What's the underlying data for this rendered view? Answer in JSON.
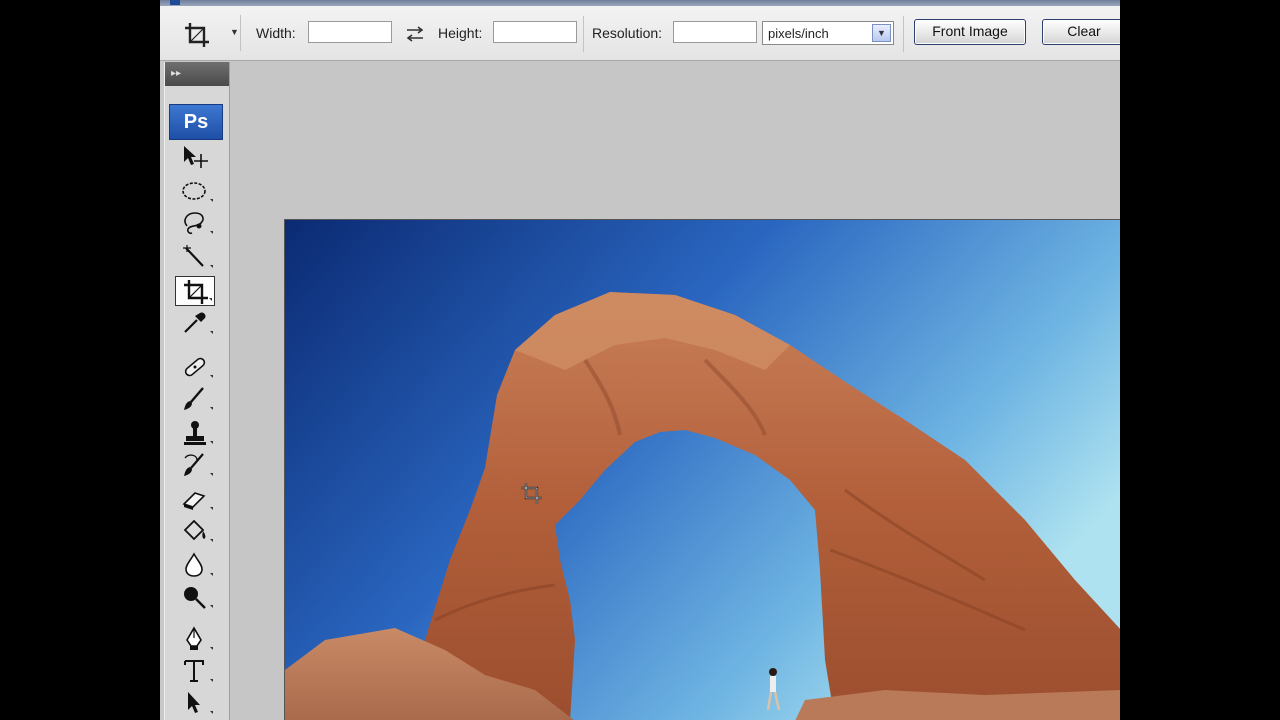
{
  "options_bar": {
    "width_label": "Width:",
    "width_value": "",
    "height_label": "Height:",
    "height_value": "",
    "resolution_label": "Resolution:",
    "resolution_value": "",
    "resolution_unit": "pixels/inch",
    "front_image_button": "Front Image",
    "clear_button": "Clear"
  },
  "toolbox": {
    "logo": "Ps",
    "tools": [
      "move-icon",
      "elliptical-marquee-icon",
      "lasso-icon",
      "magic-wand-icon",
      "crop-icon",
      "eyedropper-icon",
      "healing-brush-icon",
      "brush-icon",
      "clone-stamp-icon",
      "history-brush-icon",
      "eraser-icon",
      "paint-bucket-icon",
      "blur-icon",
      "dodge-icon",
      "pen-icon",
      "type-icon",
      "path-selection-icon"
    ],
    "active_tool": "crop-icon"
  },
  "canvas": {
    "image_subject": "desert-arch-photo"
  },
  "colors": {
    "sky_dark": "#0b2a73",
    "sky_light": "#a6dcef",
    "rock": "#b8633f"
  }
}
